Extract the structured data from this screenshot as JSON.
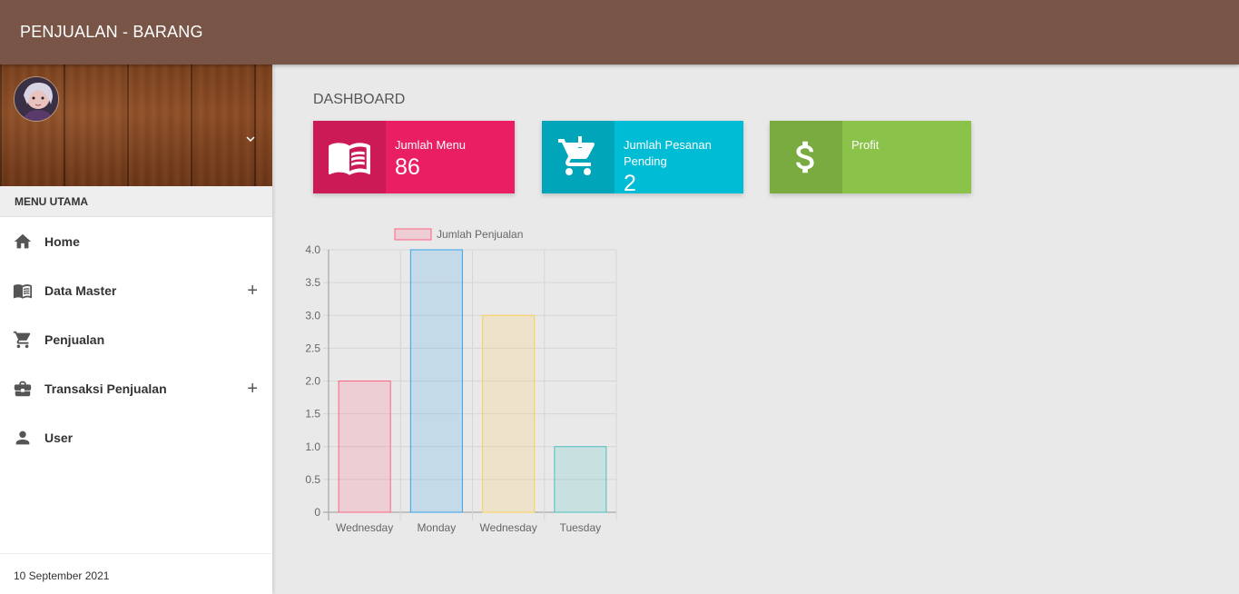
{
  "header": {
    "title": "PENJUALAN - BARANG"
  },
  "sidebar": {
    "menu_header": "MENU UTAMA",
    "items": [
      {
        "label": "Home",
        "icon": "home-icon",
        "has_submenu": false
      },
      {
        "label": "Data Master",
        "icon": "book-icon",
        "has_submenu": true
      },
      {
        "label": "Penjualan",
        "icon": "cart-icon",
        "has_submenu": false
      },
      {
        "label": "Transaksi Penjualan",
        "icon": "briefcase-icon",
        "has_submenu": true
      },
      {
        "label": "User",
        "icon": "person-icon",
        "has_submenu": false
      }
    ],
    "footer_date": "10 September 2021"
  },
  "main": {
    "page_title": "DASHBOARD",
    "info_boxes": [
      {
        "text": "Jumlah Menu",
        "number": "86",
        "icon": "book-icon",
        "color": "#e91e63"
      },
      {
        "text": "Jumlah Pesanan Pending",
        "number": "2",
        "icon": "cart-alert-icon",
        "color": "#00bcd4"
      },
      {
        "text": "Profit",
        "number": "",
        "icon": "dollar-icon",
        "color": "#8bc34a"
      }
    ]
  },
  "chart_data": {
    "type": "bar",
    "categories": [
      "Wednesday",
      "Monday",
      "Wednesday",
      "Tuesday"
    ],
    "series": [
      {
        "name": "Jumlah Penjualan",
        "values": [
          2,
          4,
          3,
          1
        ]
      }
    ],
    "bar_fills": [
      "rgba(255,99,132,0.2)",
      "rgba(54,162,235,0.2)",
      "rgba(255,206,86,0.2)",
      "rgba(75,192,192,0.2)"
    ],
    "bar_borders": [
      "#ff6384",
      "#36a2eb",
      "#ffce56",
      "#4bc0c0"
    ],
    "legend_fill": "rgba(255,99,132,0.2)",
    "legend_border": "#ff6384",
    "ylim": [
      0,
      4
    ],
    "yticks": [
      "0",
      "0.5",
      "1.0",
      "1.5",
      "2.0",
      "2.5",
      "3.0",
      "3.5",
      "4.0"
    ],
    "grid": true,
    "legend_position": "top"
  }
}
